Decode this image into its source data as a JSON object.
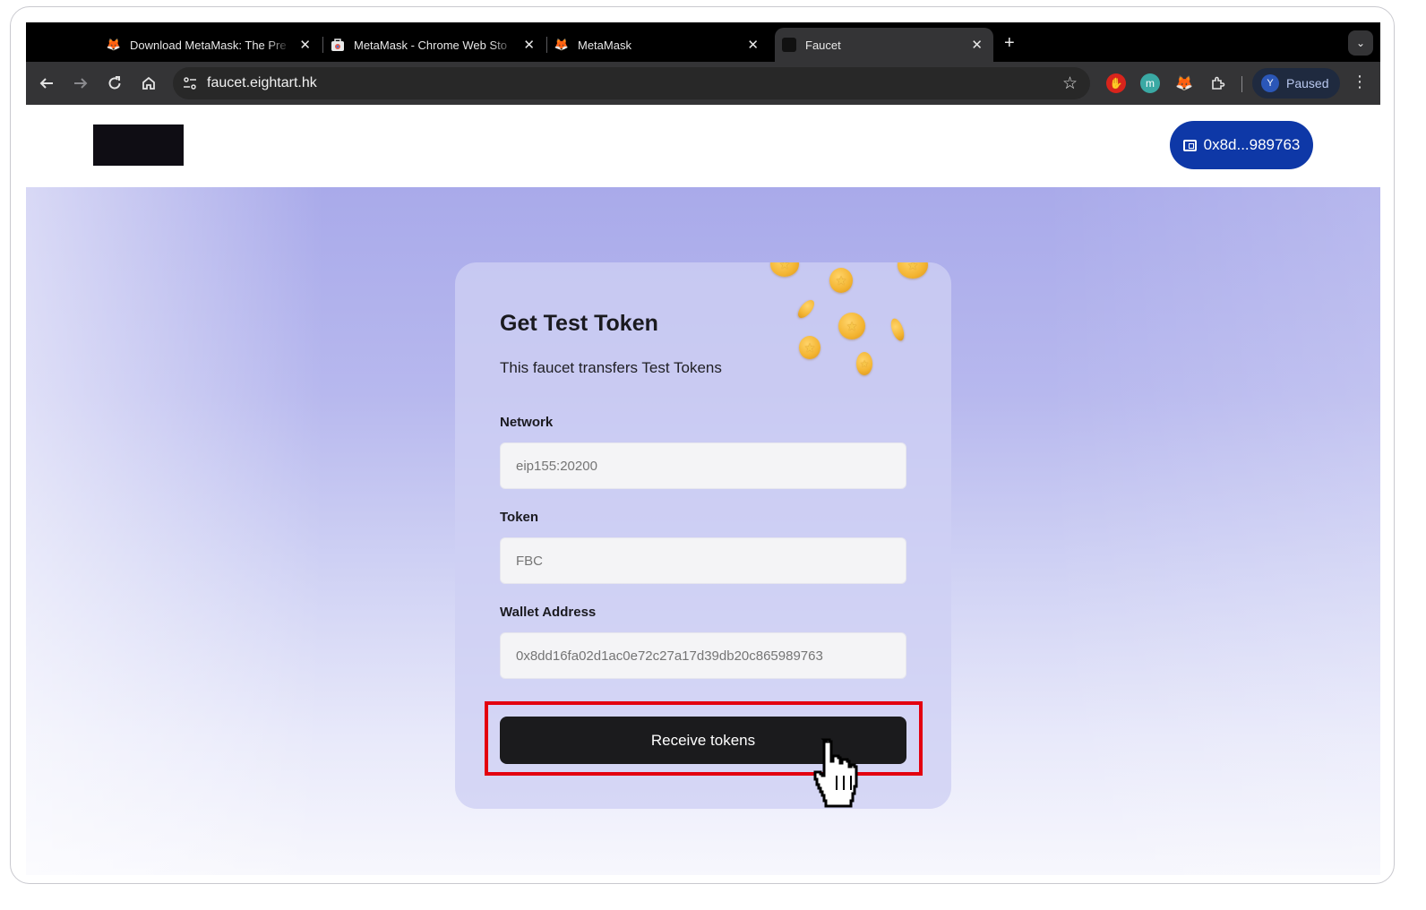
{
  "browser": {
    "tabs": [
      {
        "title": "Download MetaMask: The Pre",
        "favicon": "metamask-fox-icon"
      },
      {
        "title": "MetaMask - Chrome Web Sto",
        "favicon": "chrome-web-store-icon"
      },
      {
        "title": "MetaMask",
        "favicon": "metamask-fox-icon"
      },
      {
        "title": "Faucet",
        "favicon": "faucet-page-icon",
        "active": true
      }
    ],
    "url": "faucet.eightart.hk",
    "profile_initial": "Y",
    "profile_status": "Paused"
  },
  "header": {
    "wallet_address": "0x8d...989763"
  },
  "card": {
    "title": "Get Test Token",
    "subtitle": "This faucet transfers Test Tokens",
    "network_label": "Network",
    "network_value": "eip155:20200",
    "token_label": "Token",
    "token_value": "FBC",
    "wallet_label": "Wallet Address",
    "wallet_value": "0x8dd16fa02d1ac0e72c27a17d39db20c865989763",
    "receive_label": "Receive tokens"
  },
  "colors": {
    "accent": "#0e38a7",
    "button": "#1b1b1d",
    "highlight": "#e3000f"
  }
}
